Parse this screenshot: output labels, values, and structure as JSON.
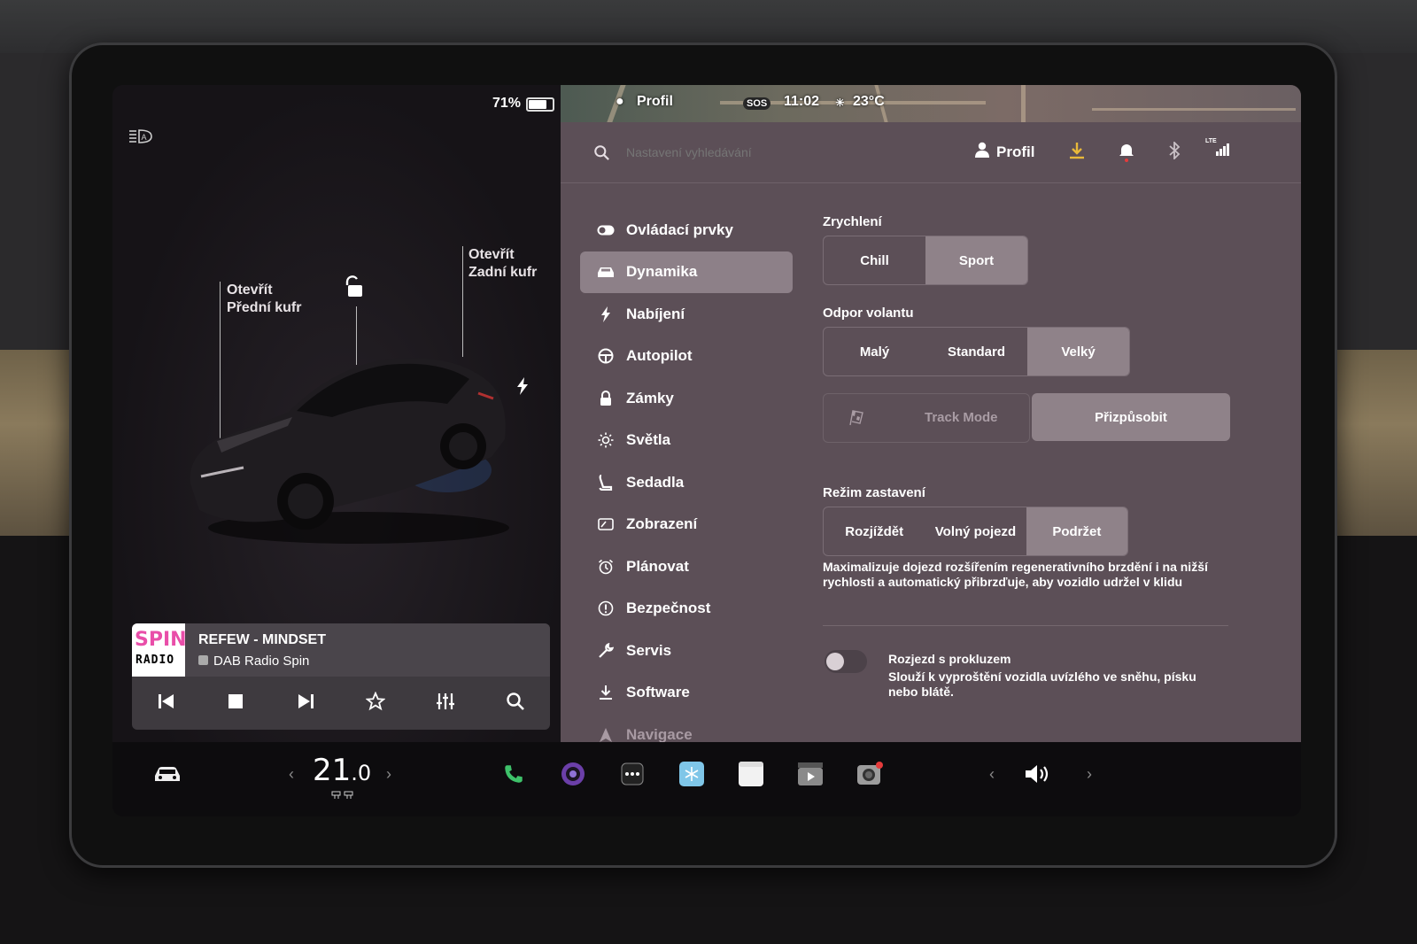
{
  "status": {
    "battery_pct": "71%"
  },
  "car": {
    "front_trunk": {
      "line1": "Otevřít",
      "line2": "Přední kufr"
    },
    "rear_trunk": {
      "line1": "Otevřít",
      "line2": "Zadní kufr"
    }
  },
  "media": {
    "logo_top": "SPIN",
    "logo_bottom": "RADIO",
    "title": "REFEW - MINDSET",
    "station": "DAB Radio Spin",
    "controls": [
      "previous-icon",
      "stop-icon",
      "next-icon",
      "favorite-star-icon",
      "equalizer-icon",
      "search-icon"
    ]
  },
  "map_bar": {
    "profile": "Profil",
    "sos": "SOS",
    "time": "11:02",
    "temp": "23°C"
  },
  "search": {
    "placeholder": "Nastavení vyhledávání"
  },
  "header": {
    "profile_label": "Profil"
  },
  "menu": {
    "items": [
      {
        "label": "Ovládací prvky",
        "icon": "toggle-icon"
      },
      {
        "label": "Dynamika",
        "icon": "car-icon",
        "active": true
      },
      {
        "label": "Nabíjení",
        "icon": "bolt-icon"
      },
      {
        "label": "Autopilot",
        "icon": "steering-wheel-icon"
      },
      {
        "label": "Zámky",
        "icon": "lock-icon"
      },
      {
        "label": "Světla",
        "icon": "sun-icon"
      },
      {
        "label": "Sedadla",
        "icon": "seat-icon"
      },
      {
        "label": "Zobrazení",
        "icon": "display-icon"
      },
      {
        "label": "Plánovat",
        "icon": "alarm-clock-icon"
      },
      {
        "label": "Bezpečnost",
        "icon": "info-circle-icon"
      },
      {
        "label": "Servis",
        "icon": "wrench-icon"
      },
      {
        "label": "Software",
        "icon": "download-icon"
      },
      {
        "label": "Navigace",
        "icon": "navigation-arrow-icon"
      }
    ]
  },
  "dynamics": {
    "acceleration": {
      "title": "Zrychlení",
      "options": [
        "Chill",
        "Sport"
      ],
      "selected": "Sport"
    },
    "steering": {
      "title": "Odpor volantu",
      "options": [
        "Malý",
        "Standard",
        "Velký"
      ],
      "selected": "Velký"
    },
    "track_mode": {
      "label": "Track Mode",
      "customize": "Přizpůsobit"
    },
    "stopping": {
      "title": "Režim zastavení",
      "options": [
        "Rozjíždět",
        "Volný pojezd",
        "Podržet"
      ],
      "selected": "Podržet"
    },
    "stopping_desc": "Maximalizuje dojezd rozšířením regenerativního brzdění i na nižší rychlosti a automatický přibrzďuje, aby vozidlo udržel v klidu",
    "slip_start": {
      "title": "Rozjezd s prokluzem",
      "desc": "Slouží k vyproštění vozidla uvízlého ve sněhu, písku nebo blátě.",
      "enabled": false
    }
  },
  "taskbar": {
    "temp_whole": "21",
    "temp_decimal": ".0",
    "volume_icon": "volume-icon"
  },
  "colors": {
    "panel": "#5c4f57",
    "selected": "#8f8289",
    "accent_download": "#e8b93a",
    "notification_dot": "#e53b3b"
  }
}
